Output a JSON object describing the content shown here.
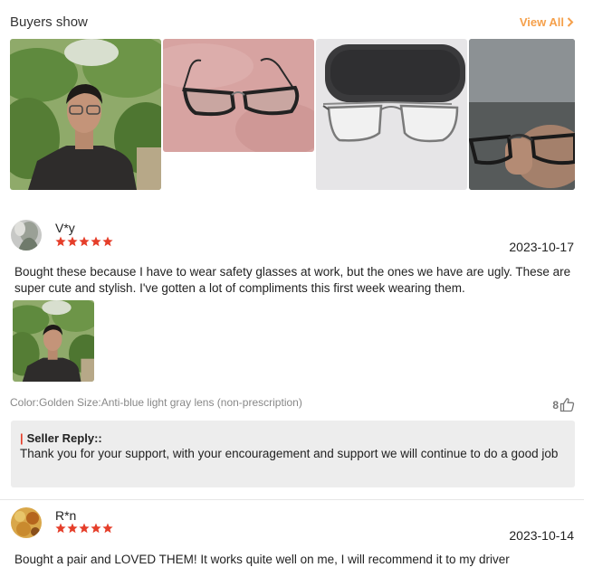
{
  "header": {
    "title": "Buyers show",
    "view_all_label": "View All"
  },
  "colors": {
    "accent": "#f5a04b",
    "star": "#e53e2a",
    "seller_reply_bg": "#ededed",
    "muted_text": "#888888"
  },
  "reviews": [
    {
      "username": "V*y",
      "rating": 5,
      "date": "2023-10-17",
      "text": "Bought these because I have to wear safety glasses at work, but the ones we have are ugly. These are super cute and stylish. I've gotten a lot of compliments this first week wearing them.",
      "variant": "Color:Golden Size:Anti-blue light gray lens (non-prescription)",
      "likes": "8",
      "seller_reply": {
        "title": "Seller Reply::",
        "text": "Thank you for your support, with your encouragement and support we will continue to do a good job"
      }
    },
    {
      "username": "R*n",
      "rating": 5,
      "date": "2023-10-14",
      "text": "Bought a pair and LOVED THEM! It works quite well on me, I will recommend it to my driver"
    }
  ]
}
